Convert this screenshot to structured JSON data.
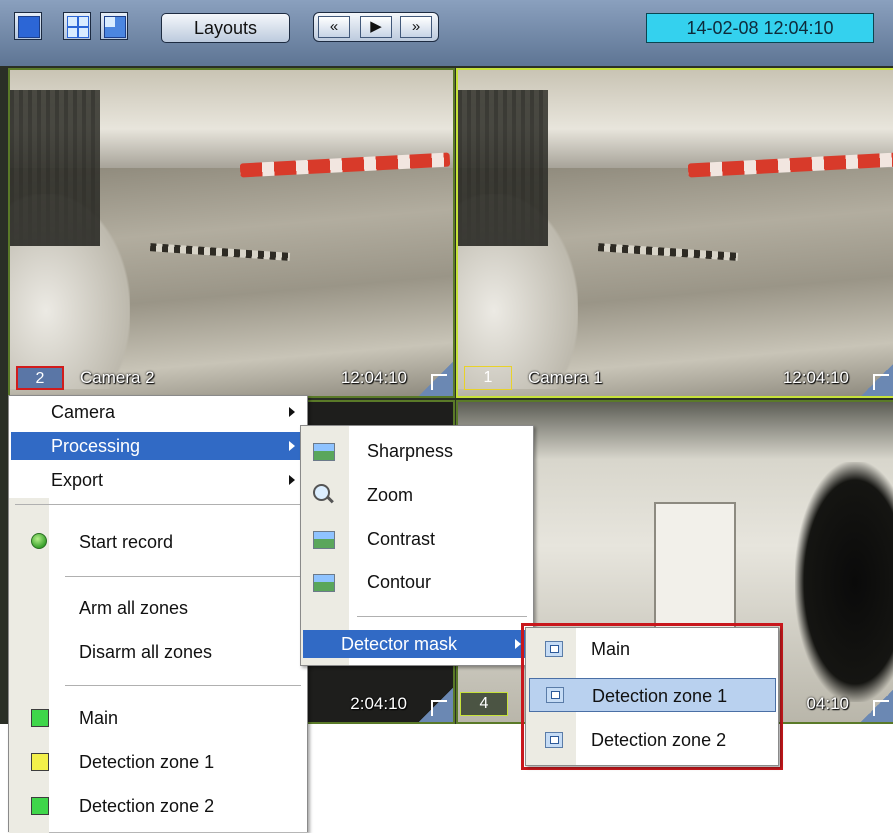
{
  "toolbar": {
    "icons": [
      "single-view-icon",
      "quad-view-icon",
      "multi-view-icon"
    ],
    "layouts_label": "Layouts",
    "nav": {
      "prev": "«",
      "play": "▶",
      "next": "»"
    },
    "datetime": "14-02-08  12:04:10"
  },
  "cameras": [
    {
      "num": "2",
      "name": "Camera 2",
      "time": "12:04:10"
    },
    {
      "num": "1",
      "name": "Camera 1",
      "time": "12:04:10"
    },
    {
      "num": "",
      "name": "",
      "time": "2:04:10"
    },
    {
      "num": "4",
      "name": "",
      "time": "04:10"
    }
  ],
  "context_menu": {
    "camera": "Camera",
    "processing": "Processing",
    "export": "Export",
    "start_record": "Start record",
    "arm_all": "Arm all zones",
    "disarm_all": "Disarm all zones",
    "zones": [
      {
        "label": "Main",
        "color": "#3fd64a"
      },
      {
        "label": "Detection zone 1",
        "color": "#f3f04a"
      },
      {
        "label": "Detection zone 2",
        "color": "#3fd64a"
      }
    ]
  },
  "processing_menu": {
    "sharpness": "Sharpness",
    "zoom": "Zoom",
    "contrast": "Contrast",
    "contour": "Contour",
    "detector_mask": "Detector mask"
  },
  "detector_mask_menu": {
    "items": [
      "Main",
      "Detection zone 1",
      "Detection zone 2"
    ],
    "selected": "Detection zone 1"
  },
  "colors": {
    "highlight": "#316ac5",
    "selected": "#b9d1ef",
    "outline_red": "#c8171c",
    "datetime_bg": "#34d1ee"
  }
}
